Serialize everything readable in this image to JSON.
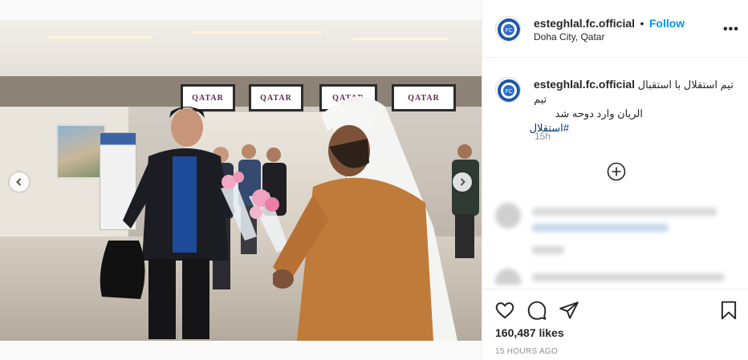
{
  "post": {
    "image_alt": "Photo of team arrival at airport",
    "carousel": {
      "dot_count": 7,
      "active_index": 1
    },
    "screen_text": "QATAR"
  },
  "header": {
    "username": "esteghlal.fc.official",
    "separator": "•",
    "follow_label": "Follow",
    "location": "Doha City, Qatar",
    "more_icon": "more-horizontal-icon"
  },
  "caption": {
    "username": "esteghlal.fc.official",
    "text_line1": "تیم استقلال با استقبال تیم",
    "text_line2": "الریان وارد دوحه شد",
    "hashtag": "#استقلال",
    "time": "15h"
  },
  "actions": {
    "like_icon": "heart-icon",
    "comment_icon": "comment-icon",
    "share_icon": "share-icon",
    "save_icon": "bookmark-icon",
    "likes": "160,487 likes",
    "timestamp": "15 HOURS AGO"
  },
  "colors": {
    "accent": "#0095f6",
    "hashtag": "#00376b",
    "muted": "#8e8e8e"
  }
}
